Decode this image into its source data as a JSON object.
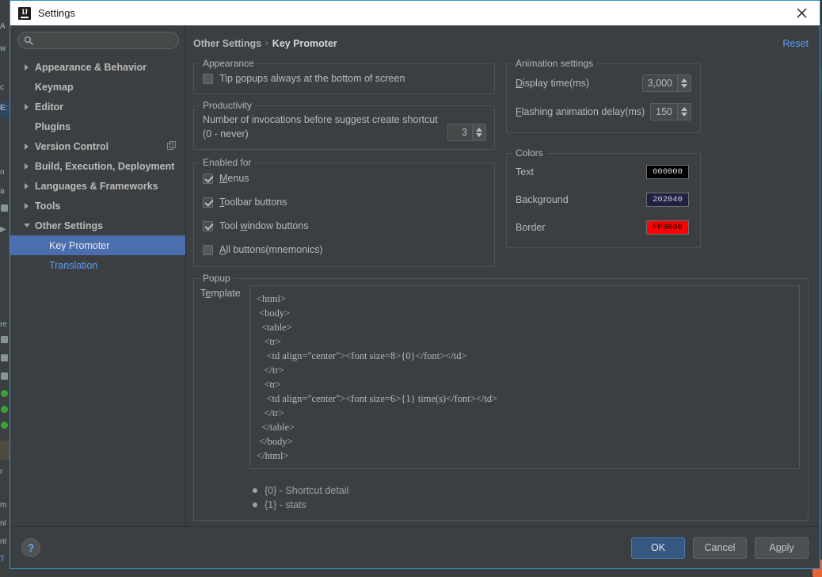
{
  "window": {
    "title": "Settings",
    "icon": "intellij-logo-icon",
    "close_icon": "close-icon"
  },
  "sidebar": {
    "search": {
      "value": "",
      "placeholder": "",
      "icon": "search-icon"
    },
    "items": [
      {
        "label": "Appearance & Behavior",
        "arrow": "right",
        "bold": true,
        "indent": false,
        "selected": false,
        "link": false,
        "badge": ""
      },
      {
        "label": "Keymap",
        "arrow": "none",
        "bold": true,
        "indent": false,
        "selected": false,
        "link": false,
        "badge": ""
      },
      {
        "label": "Editor",
        "arrow": "right",
        "bold": true,
        "indent": false,
        "selected": false,
        "link": false,
        "badge": ""
      },
      {
        "label": "Plugins",
        "arrow": "none",
        "bold": true,
        "indent": false,
        "selected": false,
        "link": false,
        "badge": ""
      },
      {
        "label": "Version Control",
        "arrow": "right",
        "bold": true,
        "indent": false,
        "selected": false,
        "link": false,
        "badge": "copy-icon"
      },
      {
        "label": "Build, Execution, Deployment",
        "arrow": "right",
        "bold": true,
        "indent": false,
        "selected": false,
        "link": false,
        "badge": ""
      },
      {
        "label": "Languages & Frameworks",
        "arrow": "right",
        "bold": true,
        "indent": false,
        "selected": false,
        "link": false,
        "badge": ""
      },
      {
        "label": "Tools",
        "arrow": "right",
        "bold": true,
        "indent": false,
        "selected": false,
        "link": false,
        "badge": ""
      },
      {
        "label": "Other Settings",
        "arrow": "down",
        "bold": true,
        "indent": false,
        "selected": false,
        "link": false,
        "badge": ""
      },
      {
        "label": "Key Promoter",
        "arrow": "none",
        "bold": false,
        "indent": true,
        "selected": true,
        "link": false,
        "badge": ""
      },
      {
        "label": "Translation",
        "arrow": "none",
        "bold": false,
        "indent": true,
        "selected": false,
        "link": true,
        "badge": ""
      }
    ]
  },
  "breadcrumb": {
    "parent": "Other Settings",
    "separator": "›",
    "current": "Key Promoter",
    "reset_label": "Reset"
  },
  "appearance_group": {
    "title": "Appearance",
    "checkbox": {
      "label_pre": "Tip ",
      "mnemonic": "p",
      "label_post": "opups always at the bottom of screen",
      "checked": false
    }
  },
  "productivity_group": {
    "title": "Productivity",
    "description": "Number of invocations before suggest create shortcut (0 - never)",
    "value": "3"
  },
  "enabled_for_group": {
    "title": "Enabled for",
    "items": [
      {
        "pre": "",
        "mnemonic": "M",
        "post": "enus",
        "checked": true
      },
      {
        "pre": "",
        "mnemonic": "T",
        "post": "oolbar buttons",
        "checked": true
      },
      {
        "pre": "Tool ",
        "mnemonic": "w",
        "post": "indow buttons",
        "checked": true
      },
      {
        "pre": "",
        "mnemonic": "A",
        "post": "ll buttons(mnemonics)",
        "checked": false
      }
    ]
  },
  "animation_group": {
    "title": "Animation settings",
    "rows": [
      {
        "pre": "",
        "mnemonic": "D",
        "post": "isplay time(ms)",
        "value": "3,000"
      },
      {
        "pre": "",
        "mnemonic": "F",
        "post": "lashing animation delay(ms)",
        "value": "150"
      }
    ]
  },
  "colors_group": {
    "title": "Colors",
    "rows": [
      {
        "label": "Text",
        "hex": "000000",
        "bg": "#000000",
        "fg": "#dcdcdc"
      },
      {
        "label": "Background",
        "hex": "202040",
        "bg": "#202040",
        "fg": "#c8c8d8"
      },
      {
        "label": "Border",
        "hex": "FF0000",
        "bg": "#ff0000",
        "fg": "#000000"
      }
    ]
  },
  "popup_group": {
    "title": "Popup",
    "template_label_pre": "T",
    "template_label_mnemonic": "e",
    "template_label_post": "mplate",
    "template_value": "<html>\n <body>\n  <table>\n   <tr>\n    <td align=\"center\"><font size=8>{0}</font></td>\n   </tr>\n   <tr>\n    <td align=\"center\"><font size=6>{1} time(s)</font></td>\n   </tr>\n  </table>\n </body>\n</html>",
    "legend": [
      "{0} - Shortcut detail",
      "{1} - stats"
    ]
  },
  "footer": {
    "help_label": "?",
    "ok_label": "OK",
    "cancel_label": "Cancel",
    "apply_pre": "A",
    "apply_mnemonic": "p",
    "apply_post": "ply"
  },
  "background": {
    "fragments": [
      "A",
      "w",
      "c",
      "E:",
      "n",
      "a",
      "re",
      "r",
      "m",
      "nl",
      "nt",
      "T"
    ]
  }
}
